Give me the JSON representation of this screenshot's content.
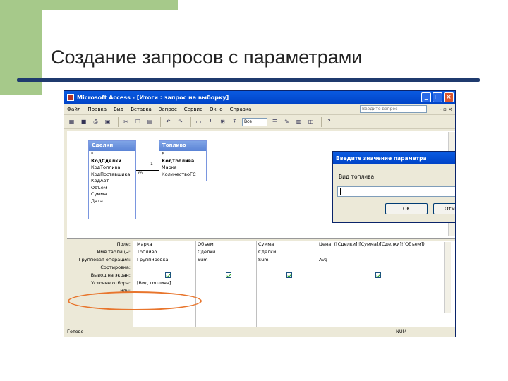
{
  "slide": {
    "title": "Создание запросов с параметрами"
  },
  "window": {
    "title": "Microsoft Access - [Итоги : запрос на выборку]",
    "menu": [
      "Файл",
      "Правка",
      "Вид",
      "Вставка",
      "Запрос",
      "Сервис",
      "Окно",
      "Справка"
    ],
    "search_placeholder": "Введите вопрос",
    "toolbar_combo": "Все",
    "tables": [
      {
        "name": "Сделки",
        "fields": [
          "*",
          "КодСделки",
          "КодТоплива",
          "КодПоставщика",
          "КодАвт",
          "Объем",
          "Сумма",
          "Дата"
        ],
        "key": "КодСделки"
      },
      {
        "name": "Топливо",
        "fields": [
          "*",
          "КодТоплива",
          "Марка",
          "КоличествоГС"
        ],
        "key": "КодТоплива"
      }
    ],
    "relation": {
      "one": "1",
      "many": "∞"
    },
    "grid": {
      "row_labels": [
        "Поле:",
        "Имя таблицы:",
        "Групповая операция:",
        "Сортировка:",
        "Вывод на экран:",
        "Условие отбора:",
        "или:"
      ],
      "columns": [
        {
          "field": "Марка",
          "table": "Топливо",
          "group": "Группировка",
          "criteria": "[Вид топлива]",
          "show": true
        },
        {
          "field": "Объем",
          "table": "Сделки",
          "group": "Sum",
          "criteria": "",
          "show": true
        },
        {
          "field": "Сумма",
          "table": "Сделки",
          "group": "Sum",
          "criteria": "",
          "show": true
        },
        {
          "field": "Цена: ([Сделки]![Сумма]/[Сделки]![Объем])",
          "table": "",
          "group": "Avg",
          "criteria": "",
          "show": true
        }
      ]
    },
    "status": "Готово",
    "status_num": "NUM"
  },
  "dialog": {
    "title": "Введите значение параметра",
    "label": "Вид топлива",
    "input_value": "",
    "ok": "OK",
    "cancel": "Отмена"
  },
  "colors": {
    "accent_green": "#a6c98a",
    "title_rule": "#1f3a6e",
    "highlight_oval": "#e8752c"
  }
}
